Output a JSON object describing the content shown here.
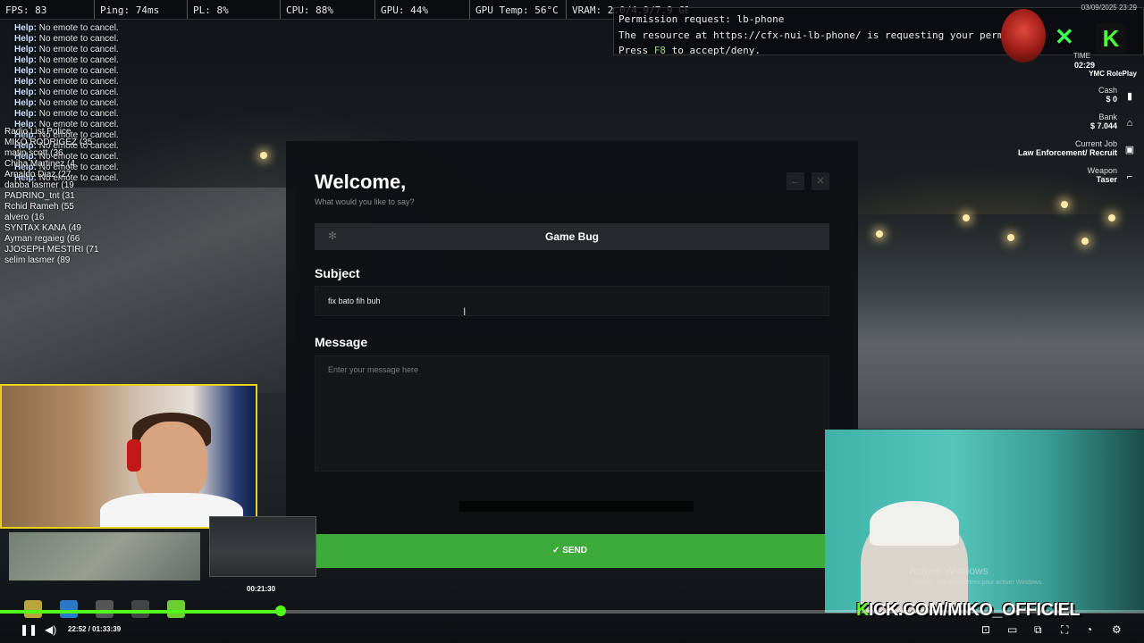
{
  "perf_bar": [
    {
      "text": "FPS: 83"
    },
    {
      "text": "Ping: 74ms"
    },
    {
      "text": "PL: 8%"
    },
    {
      "text": "CPU: 88%"
    },
    {
      "text": "GPU: 44%"
    },
    {
      "text": "GPU Temp: 56°C"
    },
    {
      "text": "VRAM: 2.0/4.9/7.9 GB"
    }
  ],
  "permission": {
    "line1": "Permission request: lb-phone",
    "line2": "The resource at https://cfx-nui-lb-phone/ is requesting your permission",
    "line3_prefix": "Press ",
    "line3_key": "F8",
    "line3_suffix": " to accept/deny."
  },
  "chat": [
    {
      "prefix": "Help:",
      "text": " No emote to cancel."
    },
    {
      "prefix": "Help:",
      "text": " No emote to cancel."
    },
    {
      "prefix": "Help:",
      "text": " No emote to cancel."
    },
    {
      "prefix": "Help:",
      "text": " No emote to cancel."
    },
    {
      "prefix": "Help:",
      "text": " No emote to cancel."
    },
    {
      "prefix": "Help:",
      "text": " No emote to cancel."
    },
    {
      "prefix": "Help:",
      "text": " No emote to cancel."
    },
    {
      "prefix": "Help:",
      "text": " No emote to cancel."
    },
    {
      "prefix": "Help:",
      "text": " No emote to cancel."
    },
    {
      "prefix": "Help:",
      "text": " No emote to cancel."
    },
    {
      "prefix": "Help:",
      "text": " No emote to cancel."
    },
    {
      "prefix": "Help:",
      "text": " No emote to cancel."
    },
    {
      "prefix": "Help:",
      "text": " No emote to cancel."
    },
    {
      "prefix": "Help:",
      "text": " No emote to cancel."
    },
    {
      "prefix": "Help:",
      "text": " No emote to cancel."
    }
  ],
  "radio_list": [
    "Radio List Police",
    "MIKO RODRIGEZ (35",
    "matin scott (36",
    "Chiha Martinez (4",
    "Arnaldo Diaz (27",
    "dabba lasmer (19",
    "PADRINO_tnt (31",
    "Rchid Rameh (55",
    "alvero (16",
    "SYNTAX KANA (49",
    "Ayman regaieg (66",
    "JJOSEPH MESTIRI (71",
    "selim lasmer (89"
  ],
  "hud": {
    "date": "03/09/2025 23:29",
    "time_label": "TIME",
    "time_value": "02:29",
    "server_name": "YMC RolePlay",
    "logo_letter": "K",
    "cash_label": "Cash",
    "cash_value": "0",
    "bank_label": "Bank",
    "bank_value": "7.044",
    "job_label": "Current Job",
    "job_value": "Law Enforcement/ Recruit",
    "weapon_label": "Weapon",
    "weapon_value": "Taser"
  },
  "panel": {
    "title": "Welcome,",
    "subtitle": "What would you like to say?",
    "category": "Game Bug",
    "subject_label": "Subject",
    "subject_value": "fix bato fih buh",
    "message_label": "Message",
    "message_placeholder": "Enter your message here",
    "send_label": "SEND"
  },
  "webcam_right": {
    "activate_title": "Activer Windows",
    "activate_sub": "Accédez aux paramètres pour activer Windows.",
    "kick_banner_k": "K",
    "kick_banner_rest": "ICK.COM/MIKO_OFFICIEL"
  },
  "player": {
    "thumb_time": "00:21:30",
    "current_time": "22:52",
    "separator": " / ",
    "total_time": "01:33:39",
    "progress": 0.245
  },
  "colors": {
    "accent_green": "#3cab3a",
    "kick_green": "#53fc18",
    "panel_bg": "#0d0f11"
  }
}
